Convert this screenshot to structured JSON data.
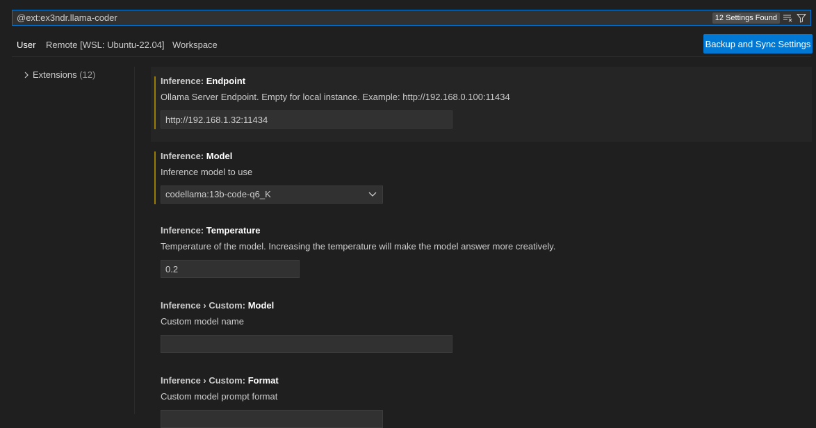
{
  "search": {
    "value": "@ext:ex3ndr.llama-coder",
    "results_badge": "12 Settings Found",
    "clear_icon": "clear-filter-icon",
    "filter_icon": "filter-icon"
  },
  "tabs": [
    {
      "label": "User",
      "active": true
    },
    {
      "label": "Remote [WSL: Ubuntu-22.04]",
      "active": false
    },
    {
      "label": "Workspace",
      "active": false
    }
  ],
  "sync_button": {
    "label": "Backup and Sync Settings"
  },
  "toc": {
    "items": [
      {
        "label": "Extensions",
        "count": "(12)",
        "icon": "chevron-right-icon"
      }
    ]
  },
  "settings": [
    {
      "category": "Inference: ",
      "name": "Endpoint",
      "description": "Ollama Server Endpoint. Empty for local instance. Example: http://192.168.0.100:11434",
      "control": "text",
      "value": "http://192.168.1.32:11434",
      "modified": true,
      "focused": true
    },
    {
      "category": "Inference: ",
      "name": "Model",
      "description": "Inference model to use",
      "control": "select",
      "value": "codellama:13b-code-q6_K",
      "modified": true,
      "focused": false
    },
    {
      "category": "Inference: ",
      "name": "Temperature",
      "description": "Temperature of the model. Increasing the temperature will make the model answer more creatively.",
      "control": "text",
      "value": "0.2",
      "modified": false,
      "focused": false
    },
    {
      "category": "Inference › Custom: ",
      "name": "Model",
      "description": "Custom model name",
      "control": "text",
      "value": "",
      "modified": false,
      "focused": false
    },
    {
      "category": "Inference › Custom: ",
      "name": "Format",
      "description": "Custom model prompt format",
      "control": "select",
      "value": "",
      "modified": false,
      "focused": false
    }
  ],
  "colors": {
    "background": "#1f1f1f",
    "accent": "#0078d4",
    "modified_indicator": "#b89500"
  }
}
